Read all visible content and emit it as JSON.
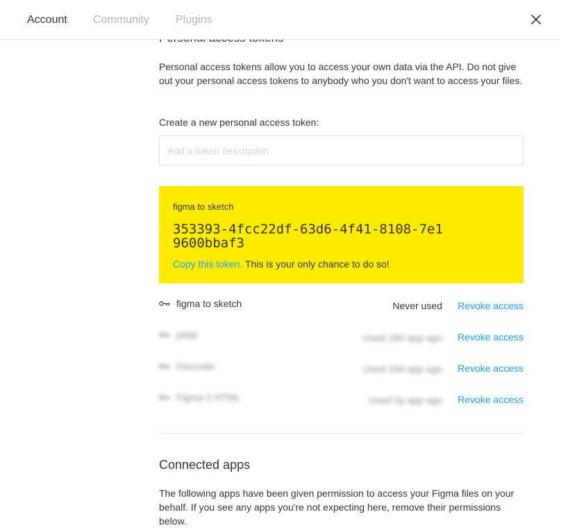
{
  "tabs": [
    {
      "label": "Account",
      "active": true
    },
    {
      "label": "Community",
      "active": false
    },
    {
      "label": "Plugins",
      "active": false
    }
  ],
  "close_icon": "close-icon",
  "personal_tokens": {
    "title": "Personal access tokens",
    "description": "Personal access tokens allow you to access your own data via the API. Do not give out your personal access tokens to anybody who you don't want to access your files.",
    "create_label": "Create a new personal access token:",
    "input_placeholder": "Add a token description",
    "input_value": ""
  },
  "new_token": {
    "name": "figma to sketch",
    "value": "353393-4fcc22df-63d6-4f41-8108-7e19600bbaf3",
    "copy_link": "Copy this token.",
    "copy_note": "This is your only chance to do so!",
    "background": "#ffeb00"
  },
  "token_list": [
    {
      "icon": "key-icon",
      "name": "figma to sketch",
      "status": "Never used",
      "action": "Revoke access",
      "blurred": false
    },
    {
      "icon": "key-icon",
      "name": "jsfdd",
      "status": "Used 184 app ago",
      "action": "Revoke access",
      "blurred": true
    },
    {
      "icon": "key-icon",
      "name": "Doccode",
      "status": "Used 184 app ago",
      "action": "Revoke access",
      "blurred": true
    },
    {
      "icon": "key-icon",
      "name": "Figma 2 HTML",
      "status": "Used 3y app ago",
      "action": "Revoke access",
      "blurred": true
    }
  ],
  "connected_apps": {
    "title": "Connected apps",
    "description": "The following apps have been given permission to access your Figma files on your behalf. If you see any apps you're not expecting here, remove their permissions below."
  },
  "colors": {
    "accent": "#18a0fb",
    "token_card": "#ffeb00",
    "muted_tab": "#b3b3b3"
  }
}
